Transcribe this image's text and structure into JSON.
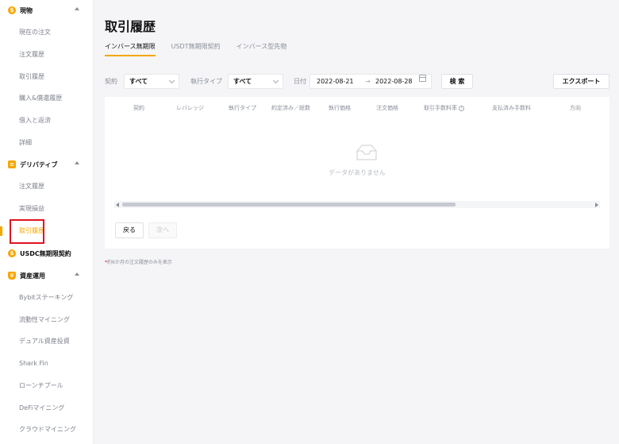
{
  "colors": {
    "accent": "#f7a600",
    "highlight": "#e0151f",
    "muted": "#8a8f99"
  },
  "sidebar": {
    "sections": [
      {
        "title": "現物",
        "icon": "spot-coin-icon",
        "items": [
          "現在の注文",
          "注文履歴",
          "取引履歴",
          "購入&償還履歴",
          "借入と返済",
          "詳細"
        ]
      },
      {
        "title": "デリバティブ",
        "icon": "derivatives-icon",
        "items": [
          "注文履歴",
          "実現損益",
          "取引履歴"
        ],
        "active_item": "取引履歴"
      },
      {
        "title": "USDC無期限契約",
        "icon": "usdc-icon",
        "items": []
      },
      {
        "title": "資産運用",
        "icon": "crown-icon",
        "items": [
          "Bybitステーキング",
          "流動性マイニング",
          "デュアル資産投資",
          "Shark Fin",
          "ローンチプール",
          "DeFiマイニング",
          "クラウドマイニング"
        ]
      }
    ]
  },
  "main": {
    "title": "取引履歴",
    "tabs": [
      {
        "label": "インバース無期限",
        "active": true
      },
      {
        "label": "USDT無期限契約",
        "active": false
      },
      {
        "label": "インバース型先物",
        "active": false
      }
    ],
    "filters": {
      "contract_label": "契約",
      "contract_value": "すべて",
      "exec_type_label": "執行タイプ",
      "exec_type_value": "すべて",
      "date_label": "日付",
      "date_from": "2022-08-21",
      "date_sep": "→",
      "date_to": "2022-08-28",
      "search_button": "検 索",
      "export_button": "エクスポート"
    },
    "table": {
      "columns": [
        "契約",
        "レバレッジ",
        "執行タイプ",
        "約定済み／総数",
        "執行価格",
        "注文価格",
        "取引手数料率",
        "支払済み手数料",
        "方向"
      ],
      "help_glyph": "?",
      "empty_text": "データがありません"
    },
    "pager": {
      "prev": "戻る",
      "next": "次へ"
    },
    "note_star": "*",
    "note": "約6か月の注文履歴のみを表示"
  }
}
